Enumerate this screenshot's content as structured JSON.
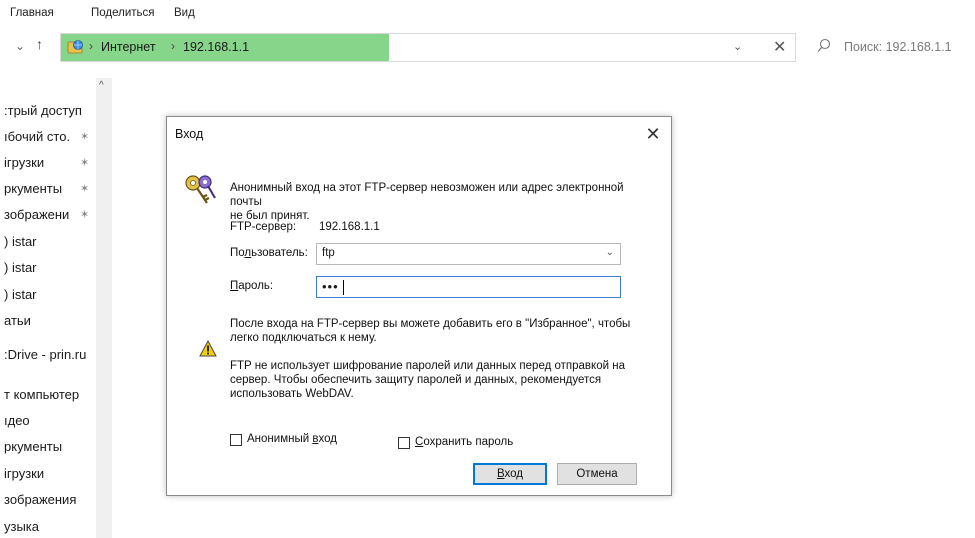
{
  "ribbon": {
    "tabs": [
      "Главная",
      "Поделиться",
      "Вид"
    ]
  },
  "nav": {
    "back": "⌄",
    "up": "↑"
  },
  "address": {
    "crumbs": [
      "Интернет",
      "192.168.1.1"
    ],
    "sep": "›",
    "dropdown": "⌄",
    "clear": "✕"
  },
  "search": {
    "placeholder": "Поиск: 192.168.1.1"
  },
  "sidebar": {
    "items": [
      {
        "label": ":трый доступ",
        "pinned": false
      },
      {
        "label": "ıбочий сто.",
        "pinned": true
      },
      {
        "label": "ігрузки",
        "pinned": true
      },
      {
        "label": "ркументы",
        "pinned": true
      },
      {
        "label": "зображени",
        "pinned": true
      },
      {
        "label": ") istar",
        "pinned": false
      },
      {
        "label": ") istar",
        "pinned": false
      },
      {
        "label": ") istar",
        "pinned": false
      },
      {
        "label": "атьи",
        "pinned": false
      },
      {
        "label": ":Drive - prin.ru",
        "pinned": false
      },
      {
        "label": "т компьютер",
        "pinned": false
      },
      {
        "label": "ıдео",
        "pinned": false
      },
      {
        "label": "ркументы",
        "pinned": false
      },
      {
        "label": "ігрузки",
        "pinned": false
      },
      {
        "label": "зображения",
        "pinned": false
      },
      {
        "label": "узыка",
        "pinned": false
      }
    ],
    "pin_glyph": "✶",
    "scroll_up": "^"
  },
  "dialog": {
    "title": "Вход",
    "close": "✕",
    "message_line1": "Анонимный вход на этот FTP-сервер невозможен или адрес электронной почты",
    "message_line2": "не был принят.",
    "server_label": "FTP-сервер:",
    "server_value": "192.168.1.1",
    "user_label_pre": "По",
    "user_label_u": "л",
    "user_label_post": "ьзователь:",
    "user_value": "ftp",
    "password_label_u": "П",
    "password_label_post": "ароль:",
    "password_mask": "•••",
    "info1_line1": "После входа на FTP-сервер вы можете добавить его в \"Избранное\", чтобы",
    "info1_line2": "легко подключаться к нему.",
    "info2_line1": "FTP не использует шифрование паролей или данных перед отправкой на",
    "info2_line2": "сервер. Чтобы обеспечить защиту паролей и данных, рекомендуется",
    "info2_line3": "использовать WebDAV.",
    "anon_pre": "Анонимный ",
    "anon_u": "в",
    "anon_post": "ход",
    "save_u": "С",
    "save_post": "охранить пароль",
    "login_u": "В",
    "login_post": "ход",
    "cancel": "Отмена"
  }
}
